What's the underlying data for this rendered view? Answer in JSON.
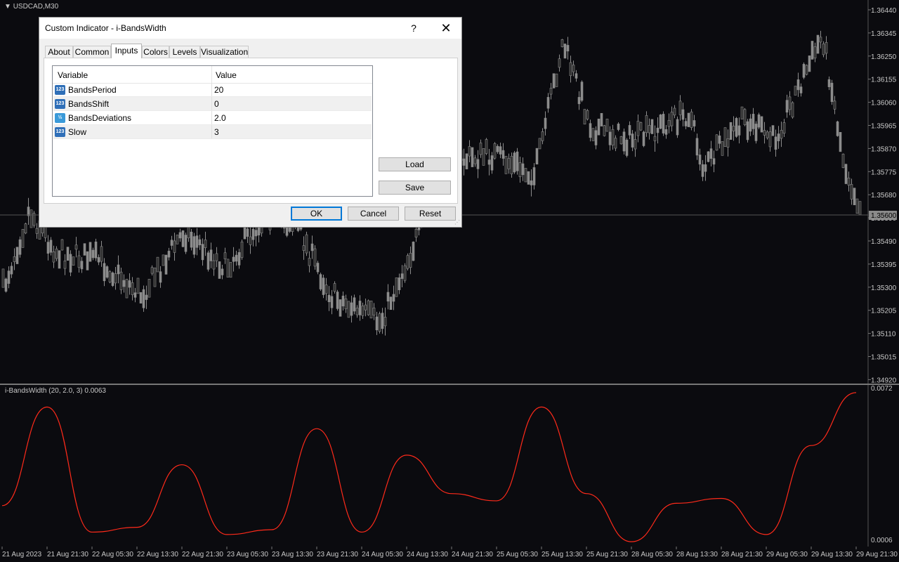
{
  "chart": {
    "symbol_label": "USDCAD,M30",
    "indicator_label": "i-BandsWidth (20, 2.0, 3) 0.0063",
    "price_ticks": [
      "1.36440",
      "1.36345",
      "1.36250",
      "1.36155",
      "1.36060",
      "1.35965",
      "1.35870",
      "1.35775",
      "1.35680",
      "1.35590",
      "1.35490",
      "1.35395",
      "1.35300",
      "1.35205",
      "1.35110",
      "1.35015",
      "1.34920"
    ],
    "current_price": "1.35600",
    "indicator_ticks": [
      "0.0072",
      "0.0006"
    ],
    "time_ticks": [
      "21 Aug 2023",
      "21 Aug 21:30",
      "22 Aug 05:30",
      "22 Aug 13:30",
      "22 Aug 21:30",
      "23 Aug 05:30",
      "23 Aug 13:30",
      "23 Aug 21:30",
      "24 Aug 05:30",
      "24 Aug 13:30",
      "24 Aug 21:30",
      "25 Aug 05:30",
      "25 Aug 13:30",
      "25 Aug 21:30",
      "28 Aug 05:30",
      "28 Aug 13:30",
      "28 Aug 21:30",
      "29 Aug 05:30",
      "29 Aug 13:30",
      "29 Aug 21:30"
    ],
    "colors": {
      "background": "#0b0b0f",
      "candles": "#8c8c8c",
      "indicator_line": "#ff2a1a",
      "text": "#c8c8c8"
    }
  },
  "chart_data": {
    "type": "line",
    "title": "i-BandsWidth (20, 2.0, 3) 0.0063",
    "xlabel": "",
    "ylabel": "",
    "ylim": [
      0.0006,
      0.0072
    ],
    "x": [
      "21 Aug 2023",
      "21 Aug 21:30",
      "22 Aug 05:30",
      "22 Aug 13:30",
      "22 Aug 21:30",
      "23 Aug 05:30",
      "23 Aug 13:30",
      "23 Aug 21:30",
      "24 Aug 05:30",
      "24 Aug 13:30",
      "24 Aug 21:30",
      "25 Aug 05:30",
      "25 Aug 13:30",
      "25 Aug 21:30",
      "28 Aug 05:30",
      "28 Aug 13:30",
      "28 Aug 21:30",
      "29 Aug 05:30",
      "29 Aug 13:30",
      "29 Aug 21:30"
    ],
    "series": [
      {
        "values": [
          0.0023,
          0.0064,
          0.0012,
          0.0014,
          0.004,
          0.0011,
          0.0013,
          0.0055,
          0.0012,
          0.0044,
          0.0028,
          0.0025,
          0.0064,
          0.0028,
          0.0008,
          0.0024,
          0.0026,
          0.0011,
          0.0048,
          0.007
        ]
      }
    ],
    "grid": false
  },
  "dialog": {
    "title": "Custom Indicator - i-BandsWidth",
    "help_glyph": "?",
    "close_glyph": "✕",
    "tabs": [
      "About",
      "Common",
      "Inputs",
      "Colors",
      "Levels",
      "Visualization"
    ],
    "active_tab": "Inputs",
    "table": {
      "headers": [
        "Variable",
        "Value"
      ],
      "rows": [
        {
          "icon": "123",
          "name": "BandsPeriod",
          "value": "20"
        },
        {
          "icon": "123",
          "name": "BandsShift",
          "value": "0"
        },
        {
          "icon": "½",
          "name": "BandsDeviations",
          "value": "2.0"
        },
        {
          "icon": "123",
          "name": "Slow",
          "value": "3"
        }
      ]
    },
    "buttons": {
      "load": "Load",
      "save": "Save",
      "ok": "OK",
      "cancel": "Cancel",
      "reset": "Reset"
    }
  }
}
